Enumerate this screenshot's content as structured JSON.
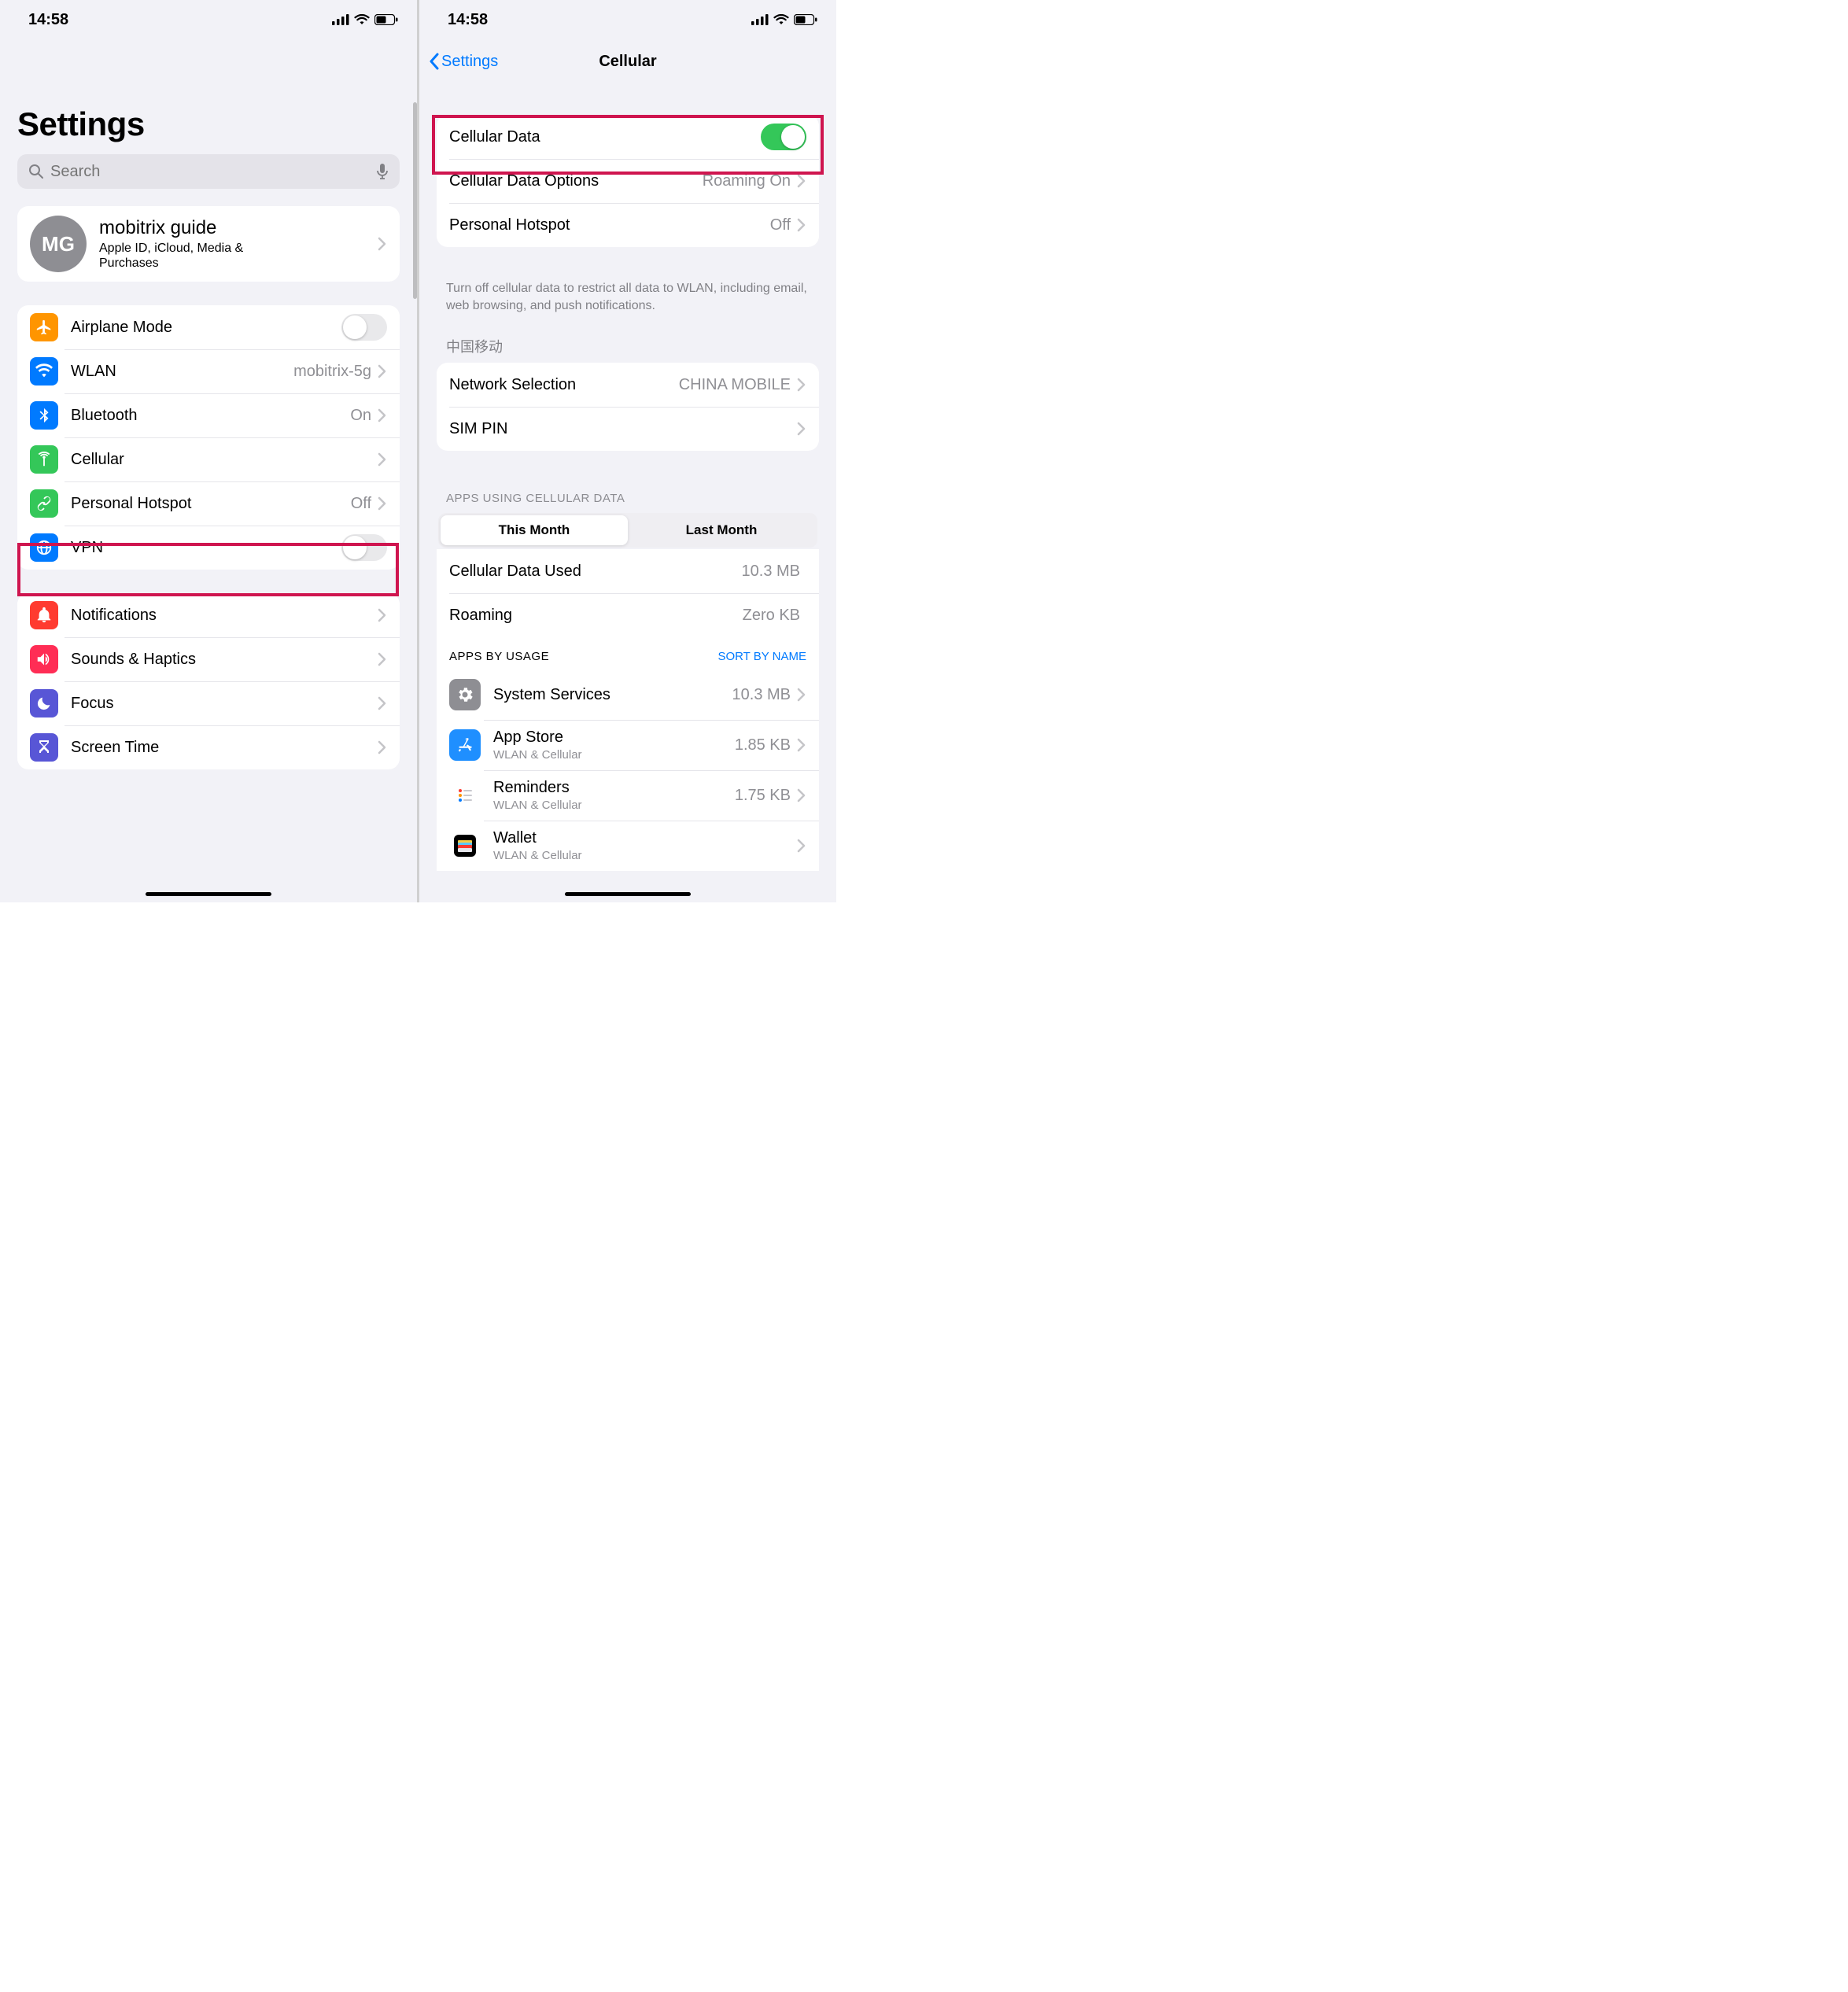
{
  "status": {
    "time": "14:58"
  },
  "left": {
    "title": "Settings",
    "search_placeholder": "Search",
    "profile": {
      "initials": "MG",
      "name": "mobitrix guide",
      "sub": "Apple ID, iCloud, Media & Purchases"
    },
    "group1": [
      {
        "label": "Airplane Mode",
        "icon": "airplane",
        "color": "#ff9500",
        "toggle": "off"
      },
      {
        "label": "WLAN",
        "icon": "wifi",
        "color": "#007aff",
        "value": "mobitrix-5g",
        "chevron": true
      },
      {
        "label": "Bluetooth",
        "icon": "bluetooth",
        "color": "#007aff",
        "value": "On",
        "chevron": true
      },
      {
        "label": "Cellular",
        "icon": "antenna",
        "color": "#34c759",
        "chevron": true
      },
      {
        "label": "Personal Hotspot",
        "icon": "link",
        "color": "#34c759",
        "value": "Off",
        "chevron": true
      },
      {
        "label": "VPN",
        "icon": "globe",
        "color": "#007aff",
        "toggle": "off"
      }
    ],
    "group2": [
      {
        "label": "Notifications",
        "icon": "bell",
        "color": "#ff3b30",
        "chevron": true
      },
      {
        "label": "Sounds & Haptics",
        "icon": "speaker",
        "color": "#ff2d55",
        "chevron": true
      },
      {
        "label": "Focus",
        "icon": "moon",
        "color": "#5856d6",
        "chevron": true
      },
      {
        "label": "Screen Time",
        "icon": "hourglass",
        "color": "#5856d6",
        "chevron": true
      }
    ]
  },
  "right": {
    "back": "Settings",
    "title": "Cellular",
    "group1": [
      {
        "label": "Cellular Data",
        "toggle": "on"
      },
      {
        "label": "Cellular Data Options",
        "value": "Roaming On",
        "chevron": true
      },
      {
        "label": "Personal Hotspot",
        "value": "Off",
        "chevron": true
      }
    ],
    "footer1": "Turn off cellular data to restrict all data to WLAN, including email, web browsing, and push notifications.",
    "carrier_header": "中国移动",
    "group2": [
      {
        "label": "Network Selection",
        "value": "CHINA MOBILE",
        "chevron": true
      },
      {
        "label": "SIM PIN",
        "chevron": true
      }
    ],
    "apps_header": "APPS USING CELLULAR DATA",
    "seg": {
      "a": "This Month",
      "b": "Last Month"
    },
    "usage": [
      {
        "label": "Cellular Data Used",
        "value": "10.3 MB"
      },
      {
        "label": "Roaming",
        "value": "Zero KB"
      }
    ],
    "apps_by": "APPS BY USAGE",
    "sort": "SORT BY NAME",
    "apps": [
      {
        "name": "System Services",
        "sub": "",
        "value": "10.3 MB",
        "color": "#8e8e93",
        "icon": "gear"
      },
      {
        "name": "App Store",
        "sub": "WLAN & Cellular",
        "value": "1.85 KB",
        "color": "#1f8fff",
        "icon": "appstore"
      },
      {
        "name": "Reminders",
        "sub": "WLAN & Cellular",
        "value": "1.75 KB",
        "color": "#ffffff",
        "icon": "reminders"
      },
      {
        "name": "Wallet",
        "sub": "WLAN & Cellular",
        "value": "",
        "color": "#000000",
        "icon": "wallet"
      }
    ]
  }
}
